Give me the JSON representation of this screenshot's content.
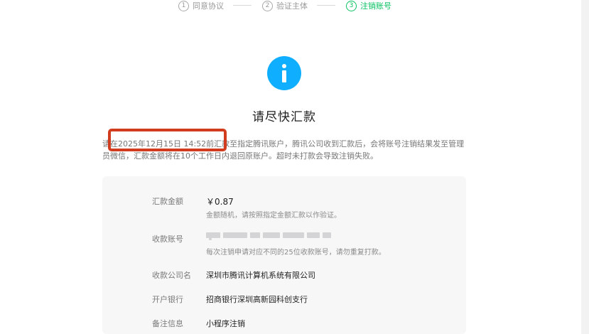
{
  "steps": [
    {
      "number": "1",
      "label": "同意协议",
      "state": "done"
    },
    {
      "number": "2",
      "label": "验证主体",
      "state": "done"
    },
    {
      "number": "3",
      "label": "注销账号",
      "state": "active"
    }
  ],
  "header": {
    "icon": "info-icon",
    "title": "请尽快汇款"
  },
  "notice": {
    "deadline_text": "请在2025年12月15日 14:52前汇款至指定腾讯账户，腾讯公司收到汇款后，会将账号注销结果发至管理员微信，汇款金额将在10个工作日内退回原账户。超时未打款会导致注销失败。"
  },
  "details": {
    "amount": {
      "label": "汇款金额",
      "value": "￥0.87",
      "hint": "金额随机，请按照指定金额汇款以作验证。"
    },
    "account": {
      "label": "收款账号",
      "value": "",
      "hint": "每次注销申请对应不同的25位收款账号，请勿重复打款。"
    },
    "company": {
      "label": "收款公司名",
      "value": "深圳市腾讯计算机系统有限公司"
    },
    "bank": {
      "label": "开户银行",
      "value": "招商银行深圳高新园科创支行"
    },
    "remark": {
      "label": "备注信息",
      "value": "小程序注销"
    }
  },
  "colors": {
    "accent_green": "#07c160",
    "info_blue": "#10aeff",
    "highlight_red": "#d23c1e"
  }
}
